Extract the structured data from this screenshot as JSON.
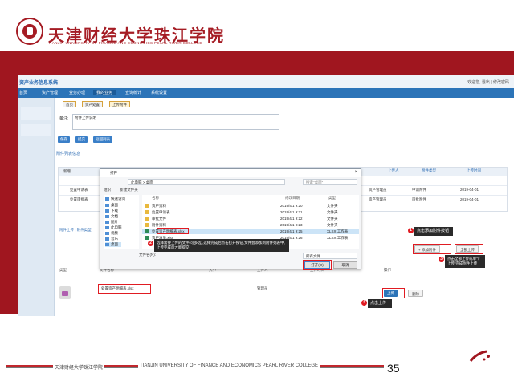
{
  "header": {
    "university_cn": "天津财经大学珠江学院",
    "university_en": "TIANJIN UNIVERSITY OF FINANCE AND ECONOMICS PEARL RIVER COLLEGE"
  },
  "app": {
    "title": "资产业务信息系统",
    "user_info": "欢迎您, 退出 | 修改密码",
    "nav": [
      {
        "label": "首页"
      },
      {
        "label": "资产管理"
      },
      {
        "label": "业务办理"
      },
      {
        "label": "我的业务"
      },
      {
        "label": "查询统计"
      },
      {
        "label": "系统设置"
      }
    ],
    "tabs": [
      {
        "label": "首页"
      },
      {
        "label": "资产处置"
      },
      {
        "label": "上传附件"
      }
    ],
    "form": {
      "remark_label": "备注:",
      "remark_value": "附件上传说明",
      "buttons": [
        {
          "label": "保存"
        },
        {
          "label": "提交"
        },
        {
          "label": "返回列表"
        }
      ]
    },
    "section_label": "附件列表信息",
    "grid": {
      "toolbar_label": "新增",
      "right_headers": [
        "上传人",
        "附件类型",
        "上传时间"
      ],
      "rows": [
        {
          "name": "处置申请表",
          "uploader": "资产管理员",
          "type": "申请附件",
          "time": "2019-04-01"
        },
        {
          "name": "处置审批表",
          "uploader": "资产管理员",
          "type": "审批附件",
          "time": "2019-04-01"
        }
      ]
    },
    "attach_label": "附件上传 | 附件类型",
    "attach_head": {
      "type": "类型",
      "name": "文件名称",
      "size": "大小",
      "uploader": "上传人",
      "time": "上传时间",
      "action": "操作"
    },
    "attachment": {
      "name": "处置资产明细表.xlsx",
      "uploader": "管理员"
    },
    "buttons": {
      "add_attachment": "添加附件",
      "upload_all": "全部上传",
      "upload": "上传",
      "delete": "删除"
    }
  },
  "dialog": {
    "title": "打开",
    "path": "此电脑 > 桌面",
    "search_placeholder": "搜索\"桌面\"",
    "toolbar_organize": "组织",
    "toolbar_new_folder": "新建文件夹",
    "tree": [
      "快速访问",
      "桌面",
      "下载",
      "文档",
      "图片",
      "此电脑",
      "视频",
      "音乐",
      "桌面"
    ],
    "list_headers": [
      "名称",
      "修改日期",
      "类型"
    ],
    "files": [
      {
        "name": "资产资料",
        "date": "2019/4/1 9:20",
        "type": "文件夹",
        "kind": "folder"
      },
      {
        "name": "处置申请表",
        "date": "2019/4/1 9:21",
        "type": "文件夹",
        "kind": "folder"
      },
      {
        "name": "审批文件",
        "date": "2019/4/1 9:22",
        "type": "文件夹",
        "kind": "folder"
      },
      {
        "name": "附件资料",
        "date": "2019/4/1 9:23",
        "type": "文件夹",
        "kind": "folder"
      },
      {
        "name": "处置资产明细表.xlsx",
        "date": "2019/4/1 9:25",
        "type": "XLSX 工作表",
        "kind": "xls"
      },
      {
        "name": "资产清单.xlsx",
        "date": "2019/4/1 9:26",
        "type": "XLSX 工作表",
        "kind": "xls"
      }
    ],
    "filename_label": "文件名(N):",
    "filter": "所有文件",
    "open_label": "打开(O)",
    "cancel_label": "取消"
  },
  "callouts": {
    "c1": "点击添加附件按钮",
    "c2": "选择需要上传的文件(可多选),选择完成后点击打开按钮,文件会添加到附件列表中,上传完成后才能提交",
    "c3": "点击全部上传或单个上传,完成附件上传",
    "c4": "点击上传"
  },
  "markers": [
    "1",
    "2",
    "3",
    "4"
  ],
  "footer": {
    "cn": "天津财经大学珠江学院",
    "en": "TIANJIN UNIVERSITY OF FINANCE AND ECONOMICS PEARL RIVER COLLEGE",
    "page": "35"
  },
  "colors": {
    "brand_red": "#a0161f",
    "accent_blue": "#2c74b8",
    "highlight_red": "#e01b22"
  }
}
